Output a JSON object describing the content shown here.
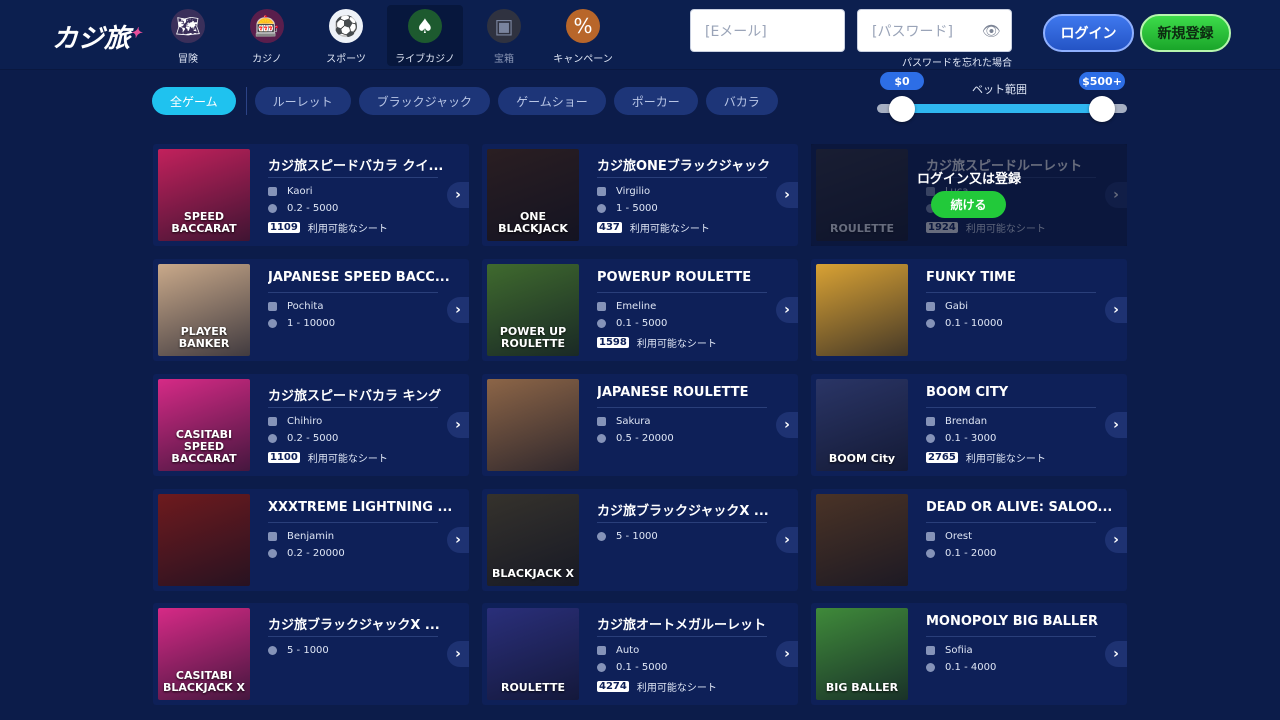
{
  "logo": {
    "text": "カジ旅"
  },
  "nav": [
    {
      "label": "冒険",
      "icon": "map-icon",
      "color": "#e2a24a"
    },
    {
      "label": "カジノ",
      "icon": "slot-machine-icon",
      "color": "#e9488f"
    },
    {
      "label": "スポーツ",
      "icon": "soccer-ball-icon",
      "color": "#ffffff"
    },
    {
      "label": "ライブカジノ",
      "icon": "live-dealer-icon",
      "color": "#2fa24d"
    },
    {
      "label": "宝箱",
      "icon": "treasure-chest-icon",
      "color": "#8c7650"
    },
    {
      "label": "キャンペーン",
      "icon": "percent-badge-icon",
      "color": "#d07a2c"
    }
  ],
  "auth": {
    "email_placeholder": "[Eメール]",
    "password_placeholder": "[パスワード]",
    "forgot": "パスワードを忘れた場合",
    "login": "ログイン",
    "register": "新規登録"
  },
  "filters": [
    "全ゲーム",
    "ルーレット",
    "ブラックジャック",
    "ゲームショー",
    "ポーカー",
    "バカラ"
  ],
  "bet": {
    "label": "ベット範囲",
    "min": "$0",
    "max": "$500+"
  },
  "overlay": {
    "text": "ログイン又は登録",
    "button": "続ける"
  },
  "seats_label": "利用可能なシート",
  "games": [
    {
      "title": "カジ旅スピードバカラ クイ...",
      "dealer": "Kaori",
      "range": "0.2 - 5000",
      "seats": "1109",
      "thumb_text": "SPEED BACCARAT",
      "thumb_color": "#c2215c"
    },
    {
      "title": "カジ旅ONEブラックジャック",
      "dealer": "Virgilio",
      "range": "1 - 5000",
      "seats": "437",
      "thumb_text": "ONE BLACKJACK",
      "thumb_color": "#2a1e22"
    },
    {
      "title": "カジ旅スピードルーレット",
      "dealer": "Luca",
      "range": "0.1 - 5000",
      "seats": "1924",
      "thumb_text": "ROULETTE",
      "thumb_color": "#33323c"
    },
    {
      "title": "JAPANESE SPEED BACC...",
      "dealer": "Pochita",
      "range": "1 - 10000",
      "seats": "",
      "thumb_text": "PLAYER BANKER",
      "thumb_color": "#c9a98a"
    },
    {
      "title": "POWERUP ROULETTE",
      "dealer": "Emeline",
      "range": "0.1 - 5000",
      "seats": "1598",
      "thumb_text": "POWER UP ROULETTE",
      "thumb_color": "#3f6a2e"
    },
    {
      "title": "FUNKY TIME",
      "dealer": "Gabi",
      "range": "0.1 - 10000",
      "seats": "",
      "thumb_text": "",
      "thumb_color": "#d9a234"
    },
    {
      "title": "カジ旅スピードバカラ キング",
      "dealer": "Chihiro",
      "range": "0.2 - 5000",
      "seats": "1100",
      "thumb_text": "CASITABI SPEED BACCARAT",
      "thumb_color": "#d62a86"
    },
    {
      "title": "JAPANESE ROULETTE",
      "dealer": "Sakura",
      "range": "0.5 - 20000",
      "seats": "",
      "thumb_text": "",
      "thumb_color": "#8c6547"
    },
    {
      "title": "BOOM CITY",
      "dealer": "Brendan",
      "range": "0.1 - 3000",
      "seats": "2765",
      "thumb_text": "BOOM City",
      "thumb_color": "#2a3566"
    },
    {
      "title": "XXXTREME LIGHTNING ...",
      "dealer": "Benjamin",
      "range": "0.2 - 20000",
      "seats": "",
      "thumb_text": "",
      "thumb_color": "#6e1a1e"
    },
    {
      "title": "カジ旅ブラックジャックX ...",
      "dealer": "",
      "range": "5 - 1000",
      "seats": "",
      "thumb_text": "BLACKJACK X",
      "thumb_color": "#35322c"
    },
    {
      "title": "DEAD OR ALIVE: SALOO...",
      "dealer": "Orest",
      "range": "0.1 - 2000",
      "seats": "",
      "thumb_text": "",
      "thumb_color": "#4a3326"
    },
    {
      "title": "カジ旅ブラックジャックX ...",
      "dealer": "",
      "range": "5 - 1000",
      "seats": "",
      "thumb_text": "CASITABI BLACKJACK X",
      "thumb_color": "#d62a86"
    },
    {
      "title": "カジ旅オートメガルーレット",
      "dealer": "Auto",
      "range": "0.1 - 5000",
      "seats": "4274",
      "thumb_text": "ROULETTE",
      "thumb_color": "#2a2f7a"
    },
    {
      "title": "MONOPOLY BIG BALLER",
      "dealer": "Sofiia",
      "range": "0.1 - 4000",
      "seats": "",
      "thumb_text": "BIG BALLER",
      "thumb_color": "#3f8a3a"
    }
  ]
}
